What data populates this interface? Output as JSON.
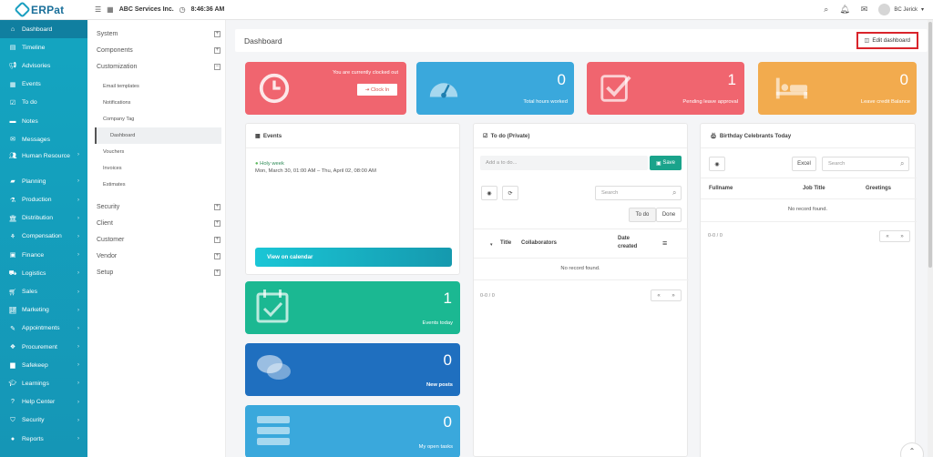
{
  "app": {
    "logo_text": "ERPat",
    "company": "ABC Services Inc.",
    "time": "8:46:36 AM",
    "user": "BC Jerick"
  },
  "sidebar": {
    "items": [
      {
        "label": "Dashboard",
        "icon": "dashboard-icon",
        "active": true
      },
      {
        "label": "Timeline",
        "icon": "timeline-icon"
      },
      {
        "label": "Advisories",
        "icon": "megaphone-icon"
      },
      {
        "label": "Events",
        "icon": "calendar-icon"
      },
      {
        "label": "To do",
        "icon": "checkbox-icon"
      },
      {
        "label": "Notes",
        "icon": "note-icon"
      },
      {
        "label": "Messages",
        "icon": "envelope-icon"
      },
      {
        "label": "Human Resource",
        "icon": "users-icon",
        "chevron": true
      },
      {
        "label": "Planning",
        "icon": "folder-icon",
        "chevron": true
      },
      {
        "label": "Production",
        "icon": "flask-icon",
        "chevron": true
      },
      {
        "label": "Distribution",
        "icon": "bank-icon",
        "chevron": true
      },
      {
        "label": "Compensation",
        "icon": "handshake-icon",
        "chevron": true
      },
      {
        "label": "Finance",
        "icon": "money-icon",
        "chevron": true
      },
      {
        "label": "Logistics",
        "icon": "truck-icon",
        "chevron": true
      },
      {
        "label": "Sales",
        "icon": "cart-icon",
        "chevron": true
      },
      {
        "label": "Marketing",
        "icon": "chart-line-icon",
        "chevron": true
      },
      {
        "label": "Appointments",
        "icon": "edit-icon",
        "chevron": true
      },
      {
        "label": "Procurement",
        "icon": "cubes-icon",
        "chevron": true
      },
      {
        "label": "Safekeep",
        "icon": "safe-icon",
        "chevron": true
      },
      {
        "label": "Learnings",
        "icon": "graduation-icon",
        "chevron": true
      },
      {
        "label": "Help Center",
        "icon": "help-icon",
        "chevron": true
      },
      {
        "label": "Security",
        "icon": "shield-icon",
        "chevron": true
      },
      {
        "label": "Reports",
        "icon": "report-icon",
        "chevron": true
      }
    ]
  },
  "submenu": {
    "system": "System",
    "components": "Components",
    "customization": "Customization",
    "customization_items": [
      "Email templates",
      "Notifications",
      "Company Tag",
      "Dashboard",
      "Vouchers",
      "Invoices",
      "Estimates"
    ],
    "lower": [
      "Security",
      "Client",
      "Customer",
      "Vendor",
      "Setup"
    ]
  },
  "header": {
    "title": "Dashboard",
    "edit_label": "Edit dashboard"
  },
  "stats": {
    "clock": {
      "text": "You are currently clocked out",
      "button": "Clock In",
      "color": "#f0656f"
    },
    "hours": {
      "value": "0",
      "label": "Total hours worked",
      "color": "#3aa8dc"
    },
    "leave": {
      "value": "1",
      "label": "Pending leave approval",
      "color": "#f0656f"
    },
    "credit": {
      "value": "0",
      "label": "Leave credit Balance",
      "color": "#f2ab4e"
    }
  },
  "events": {
    "title": "Events",
    "event_name": "Holy week",
    "event_date": "Mon, March 30, 01:00 AM – Thu, April 02, 08:00 AM",
    "calendar_button": "View on calendar"
  },
  "tiles": {
    "events_today": {
      "value": "1",
      "label": "Events today",
      "color": "#1bb892"
    },
    "new_posts": {
      "value": "0",
      "label": "New posts",
      "color": "#1f6fbf"
    },
    "open_tasks": {
      "value": "0",
      "label": "My open tasks",
      "color": "#3aa8dc"
    }
  },
  "todo": {
    "title": "To do (Private)",
    "placeholder": "Add a to do...",
    "save": "Save",
    "search": "Search",
    "tab_todo": "To do",
    "tab_done": "Done",
    "columns": [
      "Title",
      "Collaborators",
      "Date created"
    ],
    "empty": "No record found.",
    "count": "0-0 / 0"
  },
  "birthday": {
    "title": "Birthday Celebrants Today",
    "excel": "Excel",
    "search": "Search",
    "columns": [
      "Fullname",
      "Job Title",
      "Greetings"
    ],
    "empty": "No record found.",
    "count": "0-0 / 0"
  }
}
